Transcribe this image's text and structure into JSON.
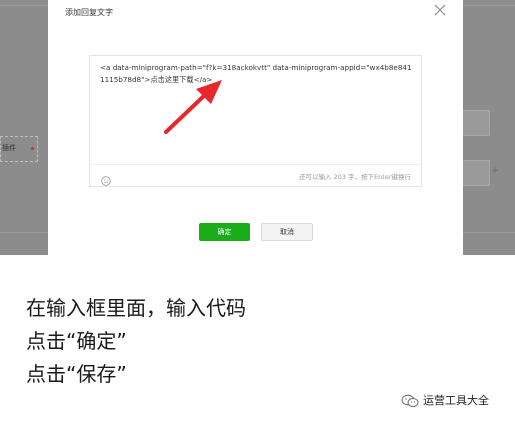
{
  "background_page": {
    "left_item_label": "插件"
  },
  "dialog": {
    "title": "添加回复文字",
    "editor_text": "<a data-miniprogram-path=\"f?k=318ackokvtt\" data-miniprogram-appid=\"wx4b8e8411115b78d8\">点击这里下载</a>",
    "char_hint": "还可以输入 203 字，按下Enter键换行",
    "confirm_label": "确定",
    "cancel_label": "取消"
  },
  "instructions": [
    "在输入框里面，输入代码",
    "点击“确定”",
    "点击“保存”"
  ],
  "brand": {
    "name": "运营工具大全"
  },
  "colors": {
    "primary_green": "#1aad19",
    "arrow_red": "#e8262b",
    "overlay_gray": "#8c8c8c"
  }
}
